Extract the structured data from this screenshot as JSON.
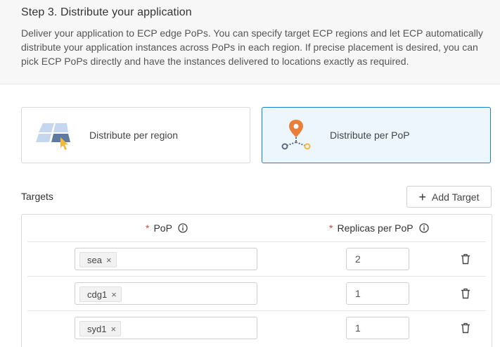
{
  "step": {
    "title": "Step 3. Distribute your application",
    "description": "Deliver your application to ECP edge PoPs. You can specify target ECP regions and let ECP automatically distribute your application instances across PoPs in each region. If precise placement is desired, you can pick ECP PoPs directly and have the instances delivered to locations exactly as required."
  },
  "distribution": {
    "options": [
      {
        "label": "Distribute per region",
        "icon": "map-region-icon",
        "selected": false
      },
      {
        "label": "Distribute per PoP",
        "icon": "pop-pin-icon",
        "selected": true
      }
    ]
  },
  "targets": {
    "label": "Targets",
    "add_label": "Add Target",
    "columns": {
      "pop": "PoP",
      "replicas": "Replicas per PoP",
      "required_mark": "*"
    },
    "rows": [
      {
        "pop": "sea",
        "replicas": "2"
      },
      {
        "pop": "cdg1",
        "replicas": "1"
      },
      {
        "pop": "syd1",
        "replicas": "1"
      }
    ]
  },
  "colors": {
    "accent": "#1b7fd3",
    "selected_bg": "#eef6fd",
    "required": "#e0433b",
    "pin_orange": "#e8803a",
    "pin_yellow": "#f0b93a",
    "map_blue": "#c5d6ef"
  }
}
